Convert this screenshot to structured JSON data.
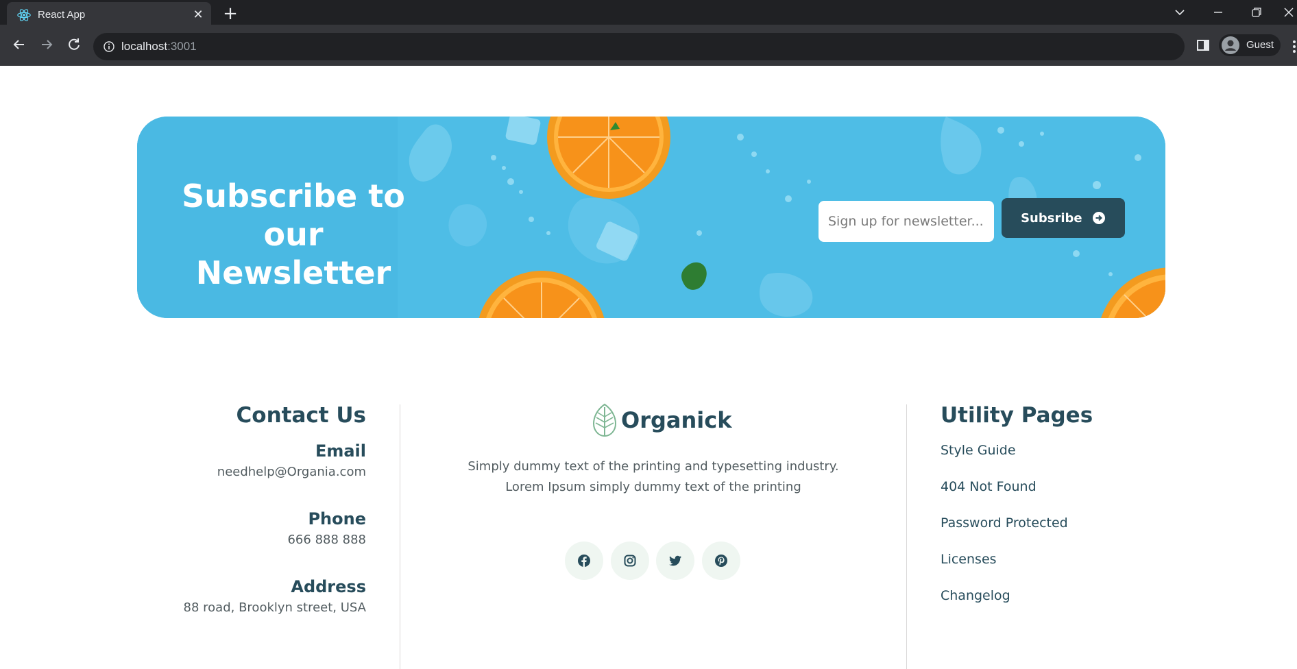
{
  "browser": {
    "tab_title": "React App",
    "url_host": "localhost",
    "url_port": ":3001",
    "profile_name": "Guest"
  },
  "newsletter": {
    "title_line1": "Subscribe to",
    "title_line2": "our Newsletter",
    "input_placeholder": "Sign up for newsletter...",
    "button_label": "Subsribe",
    "background_color": "#4ab9e3"
  },
  "footer": {
    "contact": {
      "heading": "Contact Us",
      "email_label": "Email",
      "email_value": "needhelp@Organia.com",
      "phone_label": "Phone",
      "phone_value": "666 888 888",
      "address_label": "Address",
      "address_value": "88 road, Brooklyn street, USA"
    },
    "brand": {
      "name": "Organick",
      "desc_line1": "Simply dummy text of the printing and typesetting industry.",
      "desc_line2": "Lorem Ipsum simply dummy text of the printing",
      "socials": [
        "facebook-icon",
        "instagram-icon",
        "twitter-icon",
        "pinterest-icon"
      ]
    },
    "utility": {
      "heading": "Utility Pages",
      "links": [
        "Style Guide",
        "404 Not Found",
        "Password Protected",
        "Licenses",
        "Changelog"
      ]
    }
  },
  "colors": {
    "primary": "#274c5b",
    "text_muted": "#525c60",
    "social_bg": "#eff6f1",
    "brand_green": "#7eb693"
  }
}
